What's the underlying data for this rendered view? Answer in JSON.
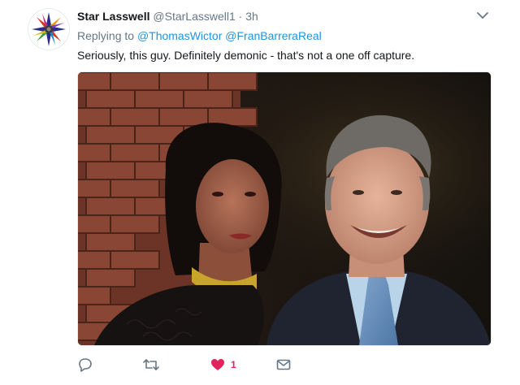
{
  "tweet": {
    "display_name": "Star Lasswell",
    "handle": "@StarLasswell1",
    "separator": "·",
    "time": "3h",
    "replying_prefix": "Replying to",
    "mentions": [
      "@ThomasWictor",
      "@FranBarreraReal"
    ],
    "text": "Seriously, this guy. Definitely demonic - that's not a one off capture.",
    "like_count": "1",
    "like_color": "#e0245e",
    "mention_color": "#1b95e0"
  },
  "icons": {
    "caret": "chevron-down-icon",
    "reply": "reply-icon",
    "retweet": "retweet-icon",
    "like": "heart-icon",
    "message": "envelope-icon"
  }
}
